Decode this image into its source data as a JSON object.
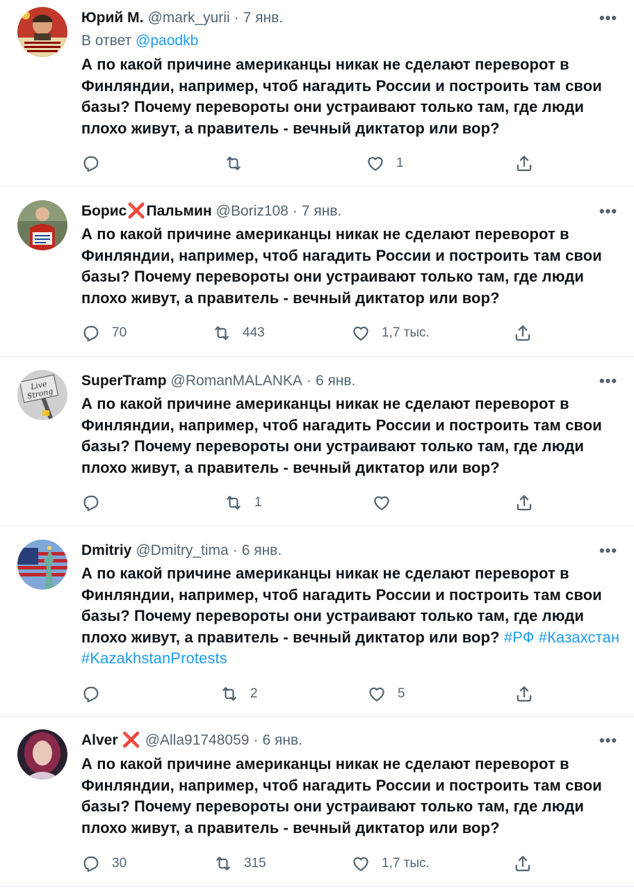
{
  "tweets": [
    {
      "name": "Юрий М.",
      "name_x": "",
      "name_suffix": "",
      "handle": "@mark_yurii",
      "date": "7 янв.",
      "reply_prefix": "В ответ",
      "reply_to": "@paodkb",
      "text": "А по какой причине американцы никак не сделают переворот в Финляндии, например, чтоб нагадить России и построить там свои базы? Почему перевороты они устраивают только там, где люди плохо живут, а правитель - вечный диктатор или вор?",
      "hashtags": "",
      "replies": "",
      "retweets": "",
      "likes": "1"
    },
    {
      "name": "Борис",
      "name_x": "❌",
      "name_suffix": "Пальмин",
      "handle": "@Boriz108",
      "date": "7 янв.",
      "text": "А по какой причине американцы никак не сделают переворот в Финляндии, например, чтоб нагадить России и построить там свои базы? Почему перевороты они устраивают только там, где люди плохо живут, а правитель - вечный диктатор или вор?",
      "hashtags": "",
      "replies": "70",
      "retweets": "443",
      "likes": "1,7 тыс."
    },
    {
      "name": "SuperTramp",
      "name_x": "",
      "name_suffix": "",
      "handle": "@RomanMALANKA",
      "date": "6 янв.",
      "avatar_text_1": "Live",
      "avatar_text_2": "Strong",
      "text": "А по какой причине американцы никак не сделают переворот в Финляндии, например, чтоб нагадить России и построить там свои базы? Почему перевороты они устраивают только там, где люди плохо живут, а правитель - вечный диктатор или вор?",
      "hashtags": "",
      "replies": "",
      "retweets": "1",
      "likes": ""
    },
    {
      "name": "Dmitriy",
      "name_x": "",
      "name_suffix": "",
      "handle": "@Dmitry_tima",
      "date": "6 янв.",
      "text": "А по какой причине американцы никак не сделают переворот в Финляндии, например, чтоб нагадить России и построить там свои базы? Почему перевороты они устраивают только там, где люди плохо живут, а правитель - вечный диктатор или вор?",
      "hashtags": "#РФ #Казахстан #KazakhstanProtests",
      "replies": "",
      "retweets": "2",
      "likes": "5"
    },
    {
      "name": "Alver",
      "name_x": "❌",
      "name_suffix": "",
      "handle": "@Alla91748059",
      "date": "6 янв.",
      "text": "А по какой причине американцы никак не сделают переворот в Финляндии, например, чтоб нагадить России и построить там свои базы? Почему перевороты они устраивают только там, где люди плохо живут, а правитель - вечный диктатор или вор?",
      "hashtags": "",
      "replies": "30",
      "retweets": "315",
      "likes": "1,7 тыс."
    }
  ],
  "more_glyph": "•••",
  "separator": "·",
  "icons": {
    "reply": "reply-icon",
    "retweet": "retweet-icon",
    "like": "like-icon",
    "share": "share-icon",
    "more": "more-icon"
  },
  "colors": {
    "link": "#1d9bf0",
    "muted": "#536471",
    "text": "#0f1419",
    "x_mark": "#e0245e"
  }
}
